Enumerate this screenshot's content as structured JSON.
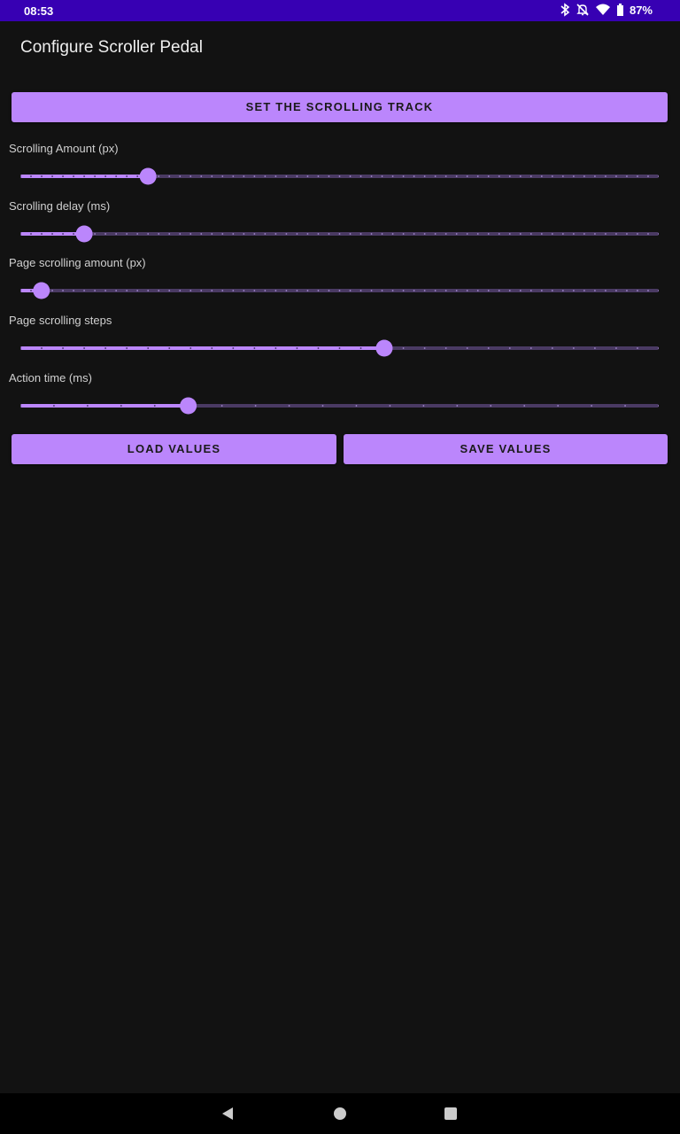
{
  "status_bar": {
    "time": "08:53",
    "battery_percent": "87%",
    "icons": [
      "bluetooth-icon",
      "notifications-off-icon",
      "wifi-icon",
      "battery-icon"
    ]
  },
  "app": {
    "title": "Configure Scroller Pedal"
  },
  "actions": {
    "set_track_label": "SET THE SCROLLING TRACK",
    "load_label": "LOAD VALUES",
    "save_label": "SAVE VALUES"
  },
  "sliders": [
    {
      "label": "Scrolling Amount (px)",
      "fraction": 0.2,
      "ticks": 60
    },
    {
      "label": "Scrolling delay (ms)",
      "fraction": 0.1,
      "ticks": 60
    },
    {
      "label": "Page scrolling amount (px)",
      "fraction": 0.033,
      "ticks": 60
    },
    {
      "label": "Page scrolling steps",
      "fraction": 0.57,
      "ticks": 30
    },
    {
      "label": "Action time (ms)",
      "fraction": 0.263,
      "ticks": 19
    }
  ],
  "colors": {
    "accent": "#bb86fc",
    "status_bar": "#3700b3",
    "background": "#121212",
    "inactive_track": "#4a3a63"
  },
  "nav_bar": {
    "icons": [
      "back-icon",
      "home-icon",
      "recents-icon"
    ]
  }
}
